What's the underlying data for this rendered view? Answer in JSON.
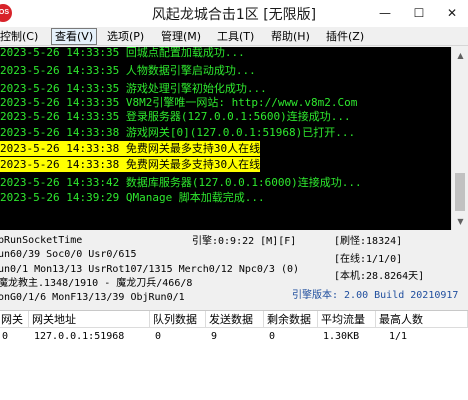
{
  "window": {
    "icon_text": "OS",
    "title": "风起龙城合击1区 [无限版]",
    "min_glyph": "—",
    "max_glyph": "☐",
    "close_glyph": "✕"
  },
  "menu": [
    {
      "label": "控制(C)"
    },
    {
      "label": "查看(V)",
      "active": true
    },
    {
      "label": "选项(P)"
    },
    {
      "label": "管理(M)"
    },
    {
      "label": "工具(T)"
    },
    {
      "label": "帮助(H)"
    },
    {
      "label": "插件(Z)"
    }
  ],
  "log": [
    {
      "text": "2023-5-26 14:33:35 回城点配置加载成功...",
      "highlight": false
    },
    {
      "text": "2023-5-26 14:33:35 人物数据引擎启动成功...",
      "highlight": false
    },
    {
      "text": "2023-5-26 14:33:35 游戏处理引擎初始化成功...",
      "highlight": false
    },
    {
      "text": "2023-5-26 14:33:35 V8M2引擎唯一网站: http://www.v8m2.Com",
      "highlight": false
    },
    {
      "text": "2023-5-26 14:33:35 登录服务器(127.0.0.1:5600)连接成功...",
      "highlight": false
    },
    {
      "text": "2023-5-26 14:33:38 游戏网关[0](127.0.0.1:51968)已打开...",
      "highlight": false
    },
    {
      "text": "2023-5-26 14:33:38 免费网关最多支持30人在线",
      "highlight": true
    },
    {
      "text": "2023-5-26 14:33:38 免费网关最多支持30人在线",
      "highlight": true
    },
    {
      "text": "2023-5-26 14:33:42 数据库服务器(127.0.0.1:6000)连接成功...",
      "highlight": false
    },
    {
      "text": "2023-5-26 14:39:29 QManage 脚本加载完成...",
      "highlight": false
    }
  ],
  "scrollbar": {
    "up": "▲",
    "down": "▼"
  },
  "status": {
    "line1_left": "bRunSocketTime",
    "line1_mid": "引擎:0:9:22 [M][F]",
    "line1_right": "[刷怪:18324]",
    "line2_left": "un60/39 Soc0/0 Usr0/615",
    "line2_right": "[在线:1/1/0]",
    "line3_left": "un0/1 Mon13/13 UsrRot107/1315 Merch0/12 Npc0/3 (0)",
    "line3_right": "[本机:28.8264天]",
    "line4_left": "魔龙教主.1348/1910 - 魔龙刀兵/466/8",
    "line5_left": "onG0/1/6 MonF13/13/39 ObjRun0/1",
    "engine_version": "引擎版本: 2.00 Build 20210917"
  },
  "gateway_table": {
    "columns": [
      "网关",
      "网关地址",
      "队列数据",
      "发送数据",
      "剩余数据",
      "平均流量",
      "最高人数"
    ],
    "rows": [
      [
        "0",
        "127.0.0.1:51968",
        "0",
        "9",
        "0",
        "1.30KB",
        "1/1"
      ]
    ]
  },
  "colors": {
    "log_text": "#2ee82e",
    "log_background": "#000000",
    "highlight_background": "#ffff00",
    "version_text": "#1f4e9e"
  }
}
